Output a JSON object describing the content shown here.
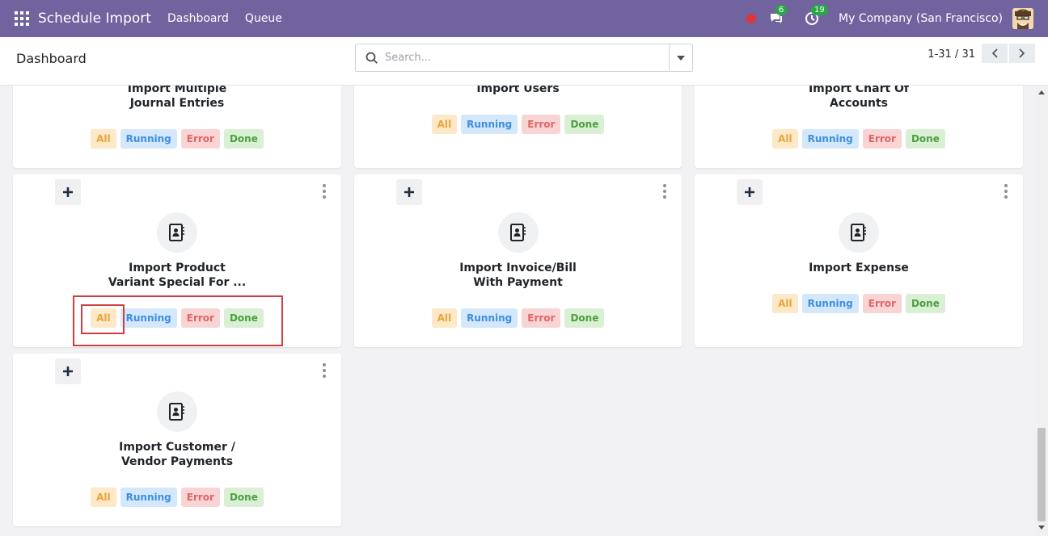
{
  "navbar": {
    "app_title": "Schedule Import",
    "links": [
      "Dashboard",
      "Queue"
    ],
    "chat_count": "6",
    "activity_count": "19",
    "company": "My Company (San Francisco)",
    "icons": [
      "apps-grid-icon",
      "record-dot-icon",
      "chat-icon",
      "clock-icon",
      "user-avatar"
    ]
  },
  "control_panel": {
    "breadcrumb": "Dashboard",
    "search_placeholder": "Search...",
    "pager": "1-31 / 31"
  },
  "tags": {
    "all": "All",
    "running": "Running",
    "error": "Error",
    "done": "Done"
  },
  "colors": {
    "navbar": "#71639e",
    "tag_all_bg": "#fde8c7",
    "tag_running_bg": "#d4e7fb",
    "tag_error_bg": "#f9d4d4",
    "tag_done_bg": "#d9f0d4",
    "highlight": "#d23c3c"
  },
  "cards": [
    {
      "title": [
        "Import Multiple",
        "Journal Entries"
      ]
    },
    {
      "title": [
        "Import Users"
      ]
    },
    {
      "title": [
        "Import Chart Of",
        "Accounts"
      ]
    },
    {
      "title": [
        "Import Product",
        "Variant Special For ..."
      ]
    },
    {
      "title": [
        "Import Invoice/Bill",
        "With Payment"
      ]
    },
    {
      "title": [
        "Import Expense"
      ]
    },
    {
      "title": [
        "Import Customer /",
        "Vendor Payments"
      ]
    }
  ]
}
